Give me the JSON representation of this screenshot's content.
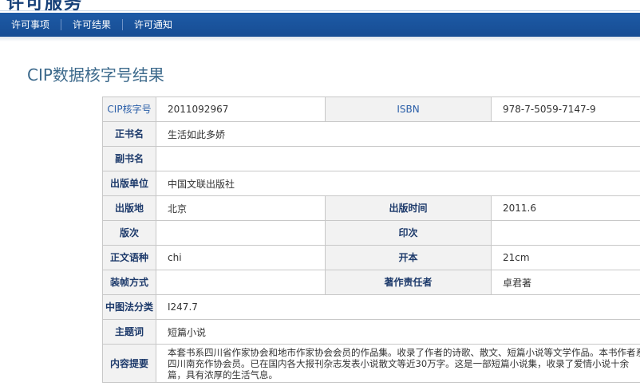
{
  "banner": {
    "logo_text": "许可服务"
  },
  "nav": {
    "items": [
      "许可事项",
      "许可结果",
      "许可通知"
    ]
  },
  "page_title": "CIP数据核字号结果",
  "record": {
    "cip_label": "CIP核字号",
    "cip_value": "2011092967",
    "isbn_label": "ISBN",
    "isbn_value": "978-7-5059-7147-9",
    "title_label": "正书名",
    "title_value": "生活如此多娇",
    "subtitle_label": "副书名",
    "subtitle_value": "",
    "publisher_label": "出版单位",
    "publisher_value": "中国文联出版社",
    "place_label": "出版地",
    "place_value": "北京",
    "pubtime_label": "出版时间",
    "pubtime_value": "2011.6",
    "edition_label": "版次",
    "edition_value": "",
    "printing_label": "印次",
    "printing_value": "",
    "language_label": "正文语种",
    "language_value": "chi",
    "format_label": "开本",
    "format_value": "21cm",
    "binding_label": "装帧方式",
    "binding_value": "",
    "author_label": "著作责任者",
    "author_value": "卓君著",
    "clc_label": "中图法分类",
    "clc_value": "I247.7",
    "subject_label": "主题词",
    "subject_value": "短篇小说",
    "summary_label": "内容提要",
    "summary_value": "本套书系四川省作家协会和地市作家协会会员的作品集。收录了作者的诗歌、散文、短篇小说等文学作品。本书作者系四川南充作协会员。已在国内各大报刊杂志发表小说散文等近30万字。这是一部短篇小说集，收录了爱情小说十余篇，具有浓厚的生活气息。"
  }
}
